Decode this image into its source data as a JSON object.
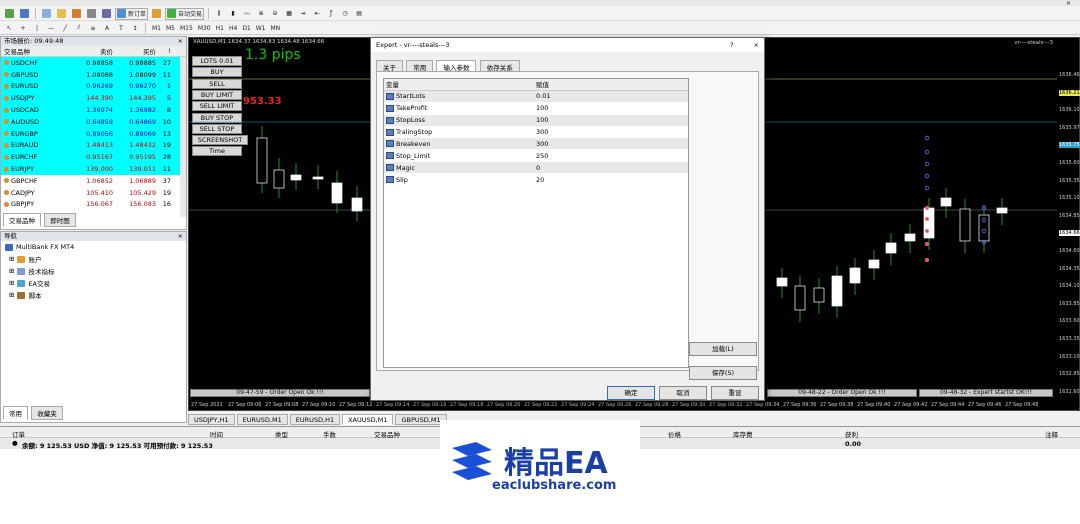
{
  "toolbar": {
    "new_order_label": "新订单",
    "auto_trade_label": "自动交易",
    "timeframes": [
      "M1",
      "M5",
      "M15",
      "M30",
      "H1",
      "H4",
      "D1",
      "W1",
      "MN"
    ]
  },
  "market_watch": {
    "title": "市场报价: 09:49:48",
    "col_symbol": "交易品种",
    "col_bid": "卖价",
    "col_ask": "买价",
    "col_spread": "!",
    "rows": [
      {
        "symbol": "USDCHF",
        "bid": "0.98858",
        "ask": "0.98885",
        "spread": "27",
        "dir": "none"
      },
      {
        "symbol": "GBPUSD",
        "bid": "1.08088",
        "ask": "1.08099",
        "spread": "11",
        "dir": "none"
      },
      {
        "symbol": "EURUSD",
        "bid": "0.96269",
        "ask": "0.96270",
        "spread": "1",
        "dir": "up"
      },
      {
        "symbol": "USDJPY",
        "bid": "144.390",
        "ask": "144.395",
        "spread": "5",
        "dir": "down"
      },
      {
        "symbol": "USDCAD",
        "bid": "1.36974",
        "ask": "1.36982",
        "spread": "8",
        "dir": "up"
      },
      {
        "symbol": "AUDUSD",
        "bid": "0.64859",
        "ask": "0.64869",
        "spread": "10",
        "dir": "up"
      },
      {
        "symbol": "EURGBP",
        "bid": "0.89056",
        "ask": "0.89069",
        "spread": "13",
        "dir": "up"
      },
      {
        "symbol": "EURAUD",
        "bid": "1.48413",
        "ask": "1.48432",
        "spread": "19",
        "dir": "down"
      },
      {
        "symbol": "EURCHF",
        "bid": "0.95167",
        "ask": "0.95195",
        "spread": "28",
        "dir": "down"
      },
      {
        "symbol": "EURJPY",
        "bid": "139.000",
        "ask": "139.011",
        "spread": "11",
        "dir": "down"
      },
      {
        "symbol": "GBPCHF",
        "bid": "1.06852",
        "ask": "1.06889",
        "spread": "37",
        "dir": "down"
      },
      {
        "symbol": "CADJPY",
        "bid": "105.410",
        "ask": "105.429",
        "spread": "19",
        "dir": "down"
      },
      {
        "symbol": "GBPJPY",
        "bid": "156.067",
        "ask": "156.083",
        "spread": "16",
        "dir": "down"
      }
    ],
    "tabs": [
      "交易品种",
      "即时图"
    ]
  },
  "navigator": {
    "title": "导航",
    "root": "MultiBank FX MT4",
    "items": [
      "账户",
      "技术指标",
      "EA交易",
      "脚本"
    ],
    "tabs": [
      "常用",
      "收藏夹"
    ]
  },
  "chart": {
    "header": "XAUUSD,M1  1634.37 1634.83 1634.48 1634.66",
    "ea_name": "vr----steals---3",
    "pips_text": "1.3 pips",
    "red_text": "953.33",
    "buttons": [
      "LOTS 0.01",
      "BUY",
      "SELL",
      "BUY LIMIT",
      "SELL LIMIT",
      "BUY STOP",
      "SELL STOP",
      "SCREENSHOT",
      "Time"
    ],
    "prices": [
      "1636.46",
      "1636.21",
      "1636.10",
      "1635.97",
      "1635.75",
      "1635.60",
      "1635.35",
      "1635.10",
      "1634.85",
      "1634.66",
      "1634.60",
      "1634.35",
      "1634.10",
      "1633.85",
      "1633.60",
      "1633.35",
      "1633.10",
      "1632.85",
      "1632.60",
      "1632.35"
    ],
    "times": [
      "27 Sep 2022",
      "27 Sep 09:06",
      "27 Sep 09:08",
      "27 Sep 09:10",
      "27 Sep 09:12",
      "27 Sep 09:14",
      "27 Sep 09:16",
      "27 Sep 09:18",
      "27 Sep 09:20",
      "27 Sep 09:22",
      "27 Sep 09:24",
      "27 Sep 09:26",
      "27 Sep 09:28",
      "27 Sep 09:30",
      "27 Sep 09:32",
      "27 Sep 09:34",
      "27 Sep 09:36",
      "27 Sep 09:38",
      "27 Sep 09:40",
      "27 Sep 09:42",
      "27 Sep 09:44",
      "27 Sep 09:46",
      "27 Sep 09:48"
    ],
    "status_left": "09-47-59 - Order Open Ok !!!",
    "status_mid": "09-48-22 - Order Open Ok !!!",
    "status_right": "09-48-32 - Expert startst OK!!!",
    "tabs": [
      "USDJPY,H1",
      "EURUSD,M1",
      "EURUSD,H1",
      "XAUUSD,M1",
      "GBPUSD,M1"
    ]
  },
  "dialog": {
    "title": "Expert - vr----steals---3",
    "help": "?",
    "close": "×",
    "tabs": [
      "关于",
      "常用",
      "输入参数",
      "依存关系"
    ],
    "col_var": "变量",
    "col_val": "赋值",
    "params": [
      {
        "name": "StartLots",
        "value": "0.01"
      },
      {
        "name": "TakeProfit",
        "value": "100"
      },
      {
        "name": "StopLoss",
        "value": "100"
      },
      {
        "name": "TralingStop",
        "value": "300"
      },
      {
        "name": "Breakeven",
        "value": "300"
      },
      {
        "name": "Stop_Limit",
        "value": "250"
      },
      {
        "name": "Magic",
        "value": "0"
      },
      {
        "name": "Slip",
        "value": "20"
      }
    ],
    "load_btn": "加载(L)",
    "save_btn": "保存(S)",
    "ok_btn": "确定",
    "cancel_btn": "取消",
    "reset_btn": "重设"
  },
  "terminal": {
    "cols": [
      "订单",
      "时间",
      "类型",
      "手数",
      "交易品种",
      "价格",
      "库存费",
      "获利",
      "注释"
    ],
    "balance_line": "余额: 9 125.53 USD  净值: 9 125.53  可用预付款: 9 125.53",
    "profit": "0.00"
  },
  "watermark": {
    "title": "精品EA",
    "url": "eaclubshare.com"
  }
}
